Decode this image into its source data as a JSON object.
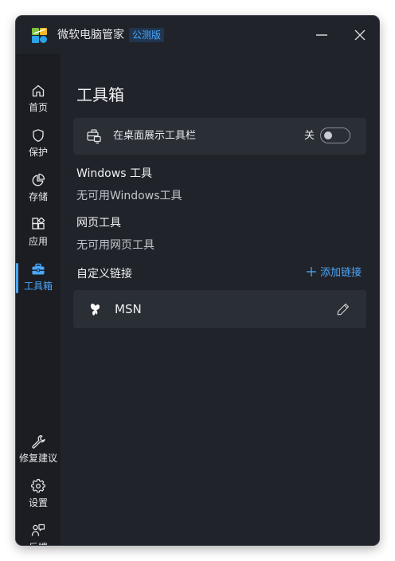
{
  "app": {
    "title": "微软电脑管家",
    "badge": "公测版",
    "accent_color": "#4aa8ff"
  },
  "window_controls": {
    "minimize_icon": "minimize-icon",
    "close_icon": "close-icon"
  },
  "sidebar": {
    "items": [
      {
        "label": "首页",
        "icon": "home-icon",
        "active": false
      },
      {
        "label": "保护",
        "icon": "shield-icon",
        "active": false
      },
      {
        "label": "存储",
        "icon": "pie-chart-icon",
        "active": false
      },
      {
        "label": "应用",
        "icon": "apps-icon",
        "active": false
      },
      {
        "label": "工具箱",
        "icon": "toolbox-icon",
        "active": true
      }
    ],
    "bottom_items": [
      {
        "label": "修复建议",
        "icon": "wrench-icon"
      },
      {
        "label": "设置",
        "icon": "gear-icon"
      },
      {
        "label": "反馈",
        "icon": "feedback-icon"
      }
    ]
  },
  "main": {
    "title": "工具箱",
    "desktop_toolbar": {
      "label": "在桌面展示工具栏",
      "toggle_state": "关",
      "toggle_on": false
    },
    "windows_tools": {
      "title": "Windows 工具",
      "empty_note": "无可用Windows工具"
    },
    "web_tools": {
      "title": "网页工具",
      "empty_note": "无可用网页工具"
    },
    "custom_links": {
      "title": "自定义链接",
      "add_label": "添加链接",
      "items": [
        {
          "label": "MSN",
          "icon": "msn-butterfly-icon"
        }
      ]
    }
  }
}
